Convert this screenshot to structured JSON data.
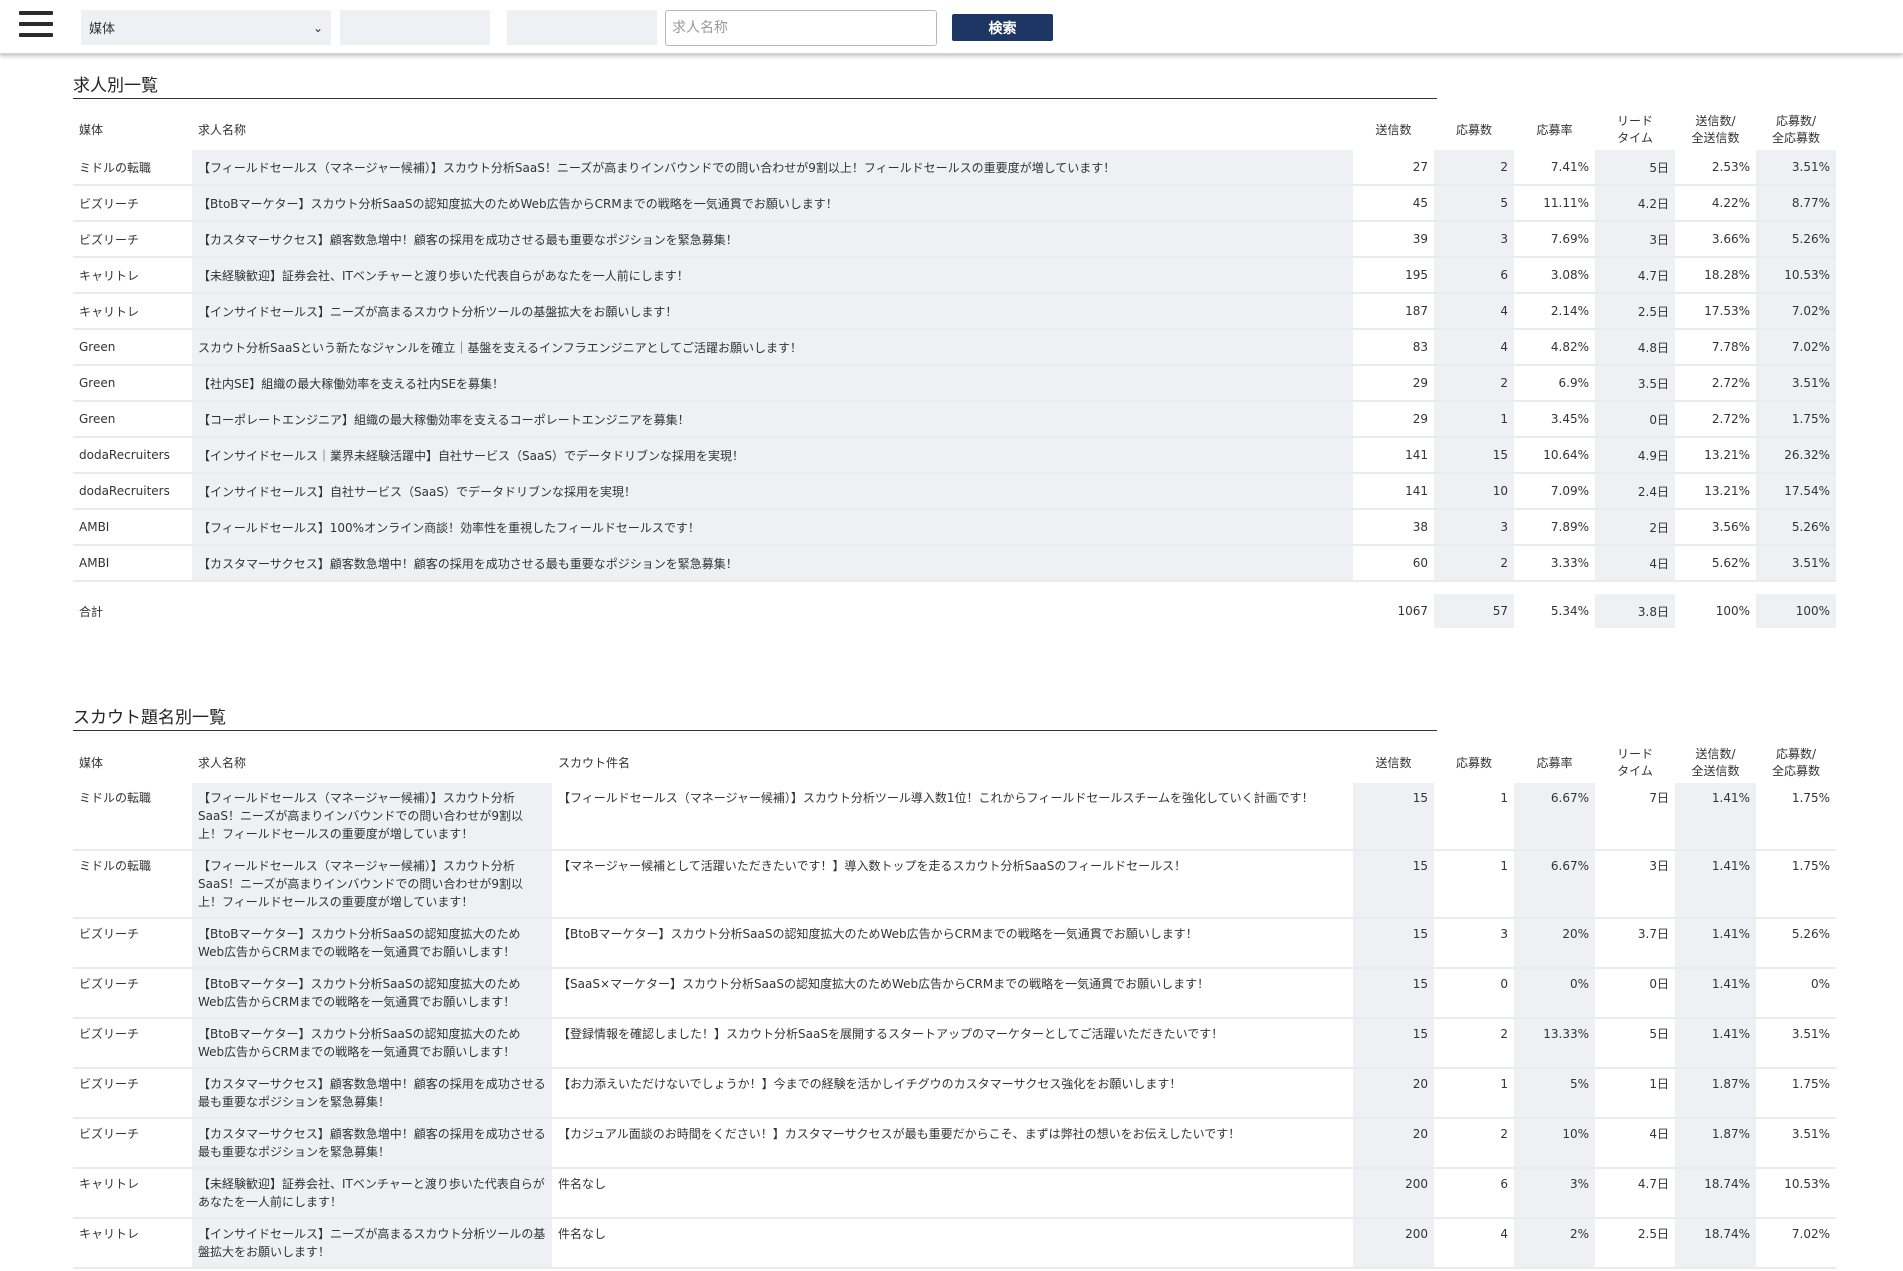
{
  "header": {
    "media_select_value": "媒体",
    "search_placeholder": "求人名称",
    "search_button": "検索"
  },
  "jobs_section": {
    "title": "求人別一覧",
    "columns": {
      "media": "媒体",
      "job_name": "求人名称",
      "sent": "送信数",
      "applied": "応募数",
      "rate": "応募率",
      "lead_1": "リード",
      "lead_2": "タイム",
      "sent_share_1": "送信数/",
      "sent_share_2": "全送信数",
      "applied_share_1": "応募数/",
      "applied_share_2": "全応募数"
    },
    "rows": [
      {
        "media": "ミドルの転職",
        "job": "【フィールドセールス（マネージャー候補）】スカウト分析SaaS！ニーズが高まりインバウンドでの問い合わせが9割以上！フィールドセールスの重要度が増しています！",
        "sent": "27",
        "applied": "2",
        "rate": "7.41%",
        "lead": "5日",
        "sent_share": "2.53%",
        "applied_share": "3.51%"
      },
      {
        "media": "ビズリーチ",
        "job": "【BtoBマーケター】スカウト分析SaaSの認知度拡大のためWeb広告からCRMまでの戦略を一気通貫でお願いします！",
        "sent": "45",
        "applied": "5",
        "rate": "11.11%",
        "lead": "4.2日",
        "sent_share": "4.22%",
        "applied_share": "8.77%"
      },
      {
        "media": "ビズリーチ",
        "job": "【カスタマーサクセス】顧客数急増中！顧客の採用を成功させる最も重要なポジションを緊急募集！",
        "sent": "39",
        "applied": "3",
        "rate": "7.69%",
        "lead": "3日",
        "sent_share": "3.66%",
        "applied_share": "5.26%"
      },
      {
        "media": "キャリトレ",
        "job": "【未経験歓迎】証券会社、ITベンチャーと渡り歩いた代表自らがあなたを一人前にします！",
        "sent": "195",
        "applied": "6",
        "rate": "3.08%",
        "lead": "4.7日",
        "sent_share": "18.28%",
        "applied_share": "10.53%"
      },
      {
        "media": "キャリトレ",
        "job": "【インサイドセールス】ニーズが高まるスカウト分析ツールの基盤拡大をお願いします！",
        "sent": "187",
        "applied": "4",
        "rate": "2.14%",
        "lead": "2.5日",
        "sent_share": "17.53%",
        "applied_share": "7.02%"
      },
      {
        "media": "Green",
        "job": "スカウト分析SaaSという新たなジャンルを確立｜基盤を支えるインフラエンジニアとしてご活躍お願いします！",
        "sent": "83",
        "applied": "4",
        "rate": "4.82%",
        "lead": "4.8日",
        "sent_share": "7.78%",
        "applied_share": "7.02%"
      },
      {
        "media": "Green",
        "job": "【社内SE】組織の最大稼働効率を支える社内SEを募集！",
        "sent": "29",
        "applied": "2",
        "rate": "6.9%",
        "lead": "3.5日",
        "sent_share": "2.72%",
        "applied_share": "3.51%"
      },
      {
        "media": "Green",
        "job": "【コーポレートエンジニア】組織の最大稼働効率を支えるコーポレートエンジニアを募集！",
        "sent": "29",
        "applied": "1",
        "rate": "3.45%",
        "lead": "0日",
        "sent_share": "2.72%",
        "applied_share": "1.75%"
      },
      {
        "media": "dodaRecruiters",
        "job": "【インサイドセールス｜業界未経験活躍中】自社サービス（SaaS）でデータドリブンな採用を実現！",
        "sent": "141",
        "applied": "15",
        "rate": "10.64%",
        "lead": "4.9日",
        "sent_share": "13.21%",
        "applied_share": "26.32%"
      },
      {
        "media": "dodaRecruiters",
        "job": "【インサイドセールス】自社サービス（SaaS）でデータドリブンな採用を実現！",
        "sent": "141",
        "applied": "10",
        "rate": "7.09%",
        "lead": "2.4日",
        "sent_share": "13.21%",
        "applied_share": "17.54%"
      },
      {
        "media": "AMBI",
        "job": "【フィールドセールス】100%オンライン商談！効率性を重視したフィールドセールスです！",
        "sent": "38",
        "applied": "3",
        "rate": "7.89%",
        "lead": "2日",
        "sent_share": "3.56%",
        "applied_share": "5.26%"
      },
      {
        "media": "AMBI",
        "job": "【カスタマーサクセス】顧客数急増中！顧客の採用を成功させる最も重要なポジションを緊急募集！",
        "sent": "60",
        "applied": "2",
        "rate": "3.33%",
        "lead": "4日",
        "sent_share": "5.62%",
        "applied_share": "3.51%"
      }
    ],
    "total": {
      "label": "合計",
      "sent": "1067",
      "applied": "57",
      "rate": "5.34%",
      "lead": "3.8日",
      "sent_share": "100%",
      "applied_share": "100%"
    }
  },
  "scouts_section": {
    "title": "スカウト題名別一覧",
    "columns": {
      "media": "媒体",
      "job_name": "求人名称",
      "scout_subject": "スカウト件名",
      "sent": "送信数",
      "applied": "応募数",
      "rate": "応募率",
      "lead_1": "リード",
      "lead_2": "タイム",
      "sent_share_1": "送信数/",
      "sent_share_2": "全送信数",
      "applied_share_1": "応募数/",
      "applied_share_2": "全応募数"
    },
    "rows": [
      {
        "media": "ミドルの転職",
        "job": "【フィールドセールス（マネージャー候補）】スカウト分析SaaS！ニーズが高まりインバウンドでの問い合わせが9割以上！フィールドセールスの重要度が増しています！",
        "subject": "【フィールドセールス（マネージャー候補）】スカウト分析ツール導入数1位！これからフィールドセールスチームを強化していく計画です！",
        "sent": "15",
        "applied": "1",
        "rate": "6.67%",
        "lead": "7日",
        "sent_share": "1.41%",
        "applied_share": "1.75%"
      },
      {
        "media": "ミドルの転職",
        "job": "【フィールドセールス（マネージャー候補）】スカウト分析SaaS！ニーズが高まりインバウンドでの問い合わせが9割以上！フィールドセールスの重要度が増しています！",
        "subject": "【マネージャー候補として活躍いただきたいです！】導入数トップを走るスカウト分析SaaSのフィールドセールス！",
        "sent": "15",
        "applied": "1",
        "rate": "6.67%",
        "lead": "3日",
        "sent_share": "1.41%",
        "applied_share": "1.75%"
      },
      {
        "media": "ビズリーチ",
        "job": "【BtoBマーケター】スカウト分析SaaSの認知度拡大のためWeb広告からCRMまでの戦略を一気通貫でお願いします！",
        "subject": "【BtoBマーケター】スカウト分析SaaSの認知度拡大のためWeb広告からCRMまでの戦略を一気通貫でお願いします！",
        "sent": "15",
        "applied": "3",
        "rate": "20%",
        "lead": "3.7日",
        "sent_share": "1.41%",
        "applied_share": "5.26%"
      },
      {
        "media": "ビズリーチ",
        "job": "【BtoBマーケター】スカウト分析SaaSの認知度拡大のためWeb広告からCRMまでの戦略を一気通貫でお願いします！",
        "subject": "【SaaS×マーケター】スカウト分析SaaSの認知度拡大のためWeb広告からCRMまでの戦略を一気通貫でお願いします！",
        "sent": "15",
        "applied": "0",
        "rate": "0%",
        "lead": "0日",
        "sent_share": "1.41%",
        "applied_share": "0%"
      },
      {
        "media": "ビズリーチ",
        "job": "【BtoBマーケター】スカウト分析SaaSの認知度拡大のためWeb広告からCRMまでの戦略を一気通貫でお願いします！",
        "subject": "【登録情報を確認しました！】スカウト分析SaaSを展開するスタートアップのマーケターとしてご活躍いただきたいです！",
        "sent": "15",
        "applied": "2",
        "rate": "13.33%",
        "lead": "5日",
        "sent_share": "1.41%",
        "applied_share": "3.51%"
      },
      {
        "media": "ビズリーチ",
        "job": "【カスタマーサクセス】顧客数急増中！顧客の採用を成功させる最も重要なポジションを緊急募集！",
        "subject": "【お力添えいただけないでしょうか！】今までの経験を活かしイチグウのカスタマーサクセス強化をお願いします！",
        "sent": "20",
        "applied": "1",
        "rate": "5%",
        "lead": "1日",
        "sent_share": "1.87%",
        "applied_share": "1.75%"
      },
      {
        "media": "ビズリーチ",
        "job": "【カスタマーサクセス】顧客数急増中！顧客の採用を成功させる最も重要なポジションを緊急募集！",
        "subject": "【カジュアル面談のお時間をください！】カスタマーサクセスが最も重要だからこそ、まずは弊社の想いをお伝えしたいです！",
        "sent": "20",
        "applied": "2",
        "rate": "10%",
        "lead": "4日",
        "sent_share": "1.87%",
        "applied_share": "3.51%"
      },
      {
        "media": "キャリトレ",
        "job": "【未経験歓迎】証券会社、ITベンチャーと渡り歩いた代表自らがあなたを一人前にします！",
        "subject": "件名なし",
        "sent": "200",
        "applied": "6",
        "rate": "3%",
        "lead": "4.7日",
        "sent_share": "18.74%",
        "applied_share": "10.53%"
      },
      {
        "media": "キャリトレ",
        "job": "【インサイドセールス】ニーズが高まるスカウト分析ツールの基盤拡大をお願いします！",
        "subject": "件名なし",
        "sent": "200",
        "applied": "4",
        "rate": "2%",
        "lead": "2.5日",
        "sent_share": "18.74%",
        "applied_share": "7.02%"
      }
    ]
  }
}
